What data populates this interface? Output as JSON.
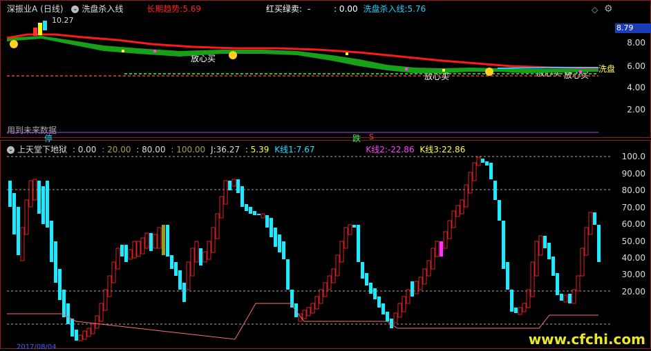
{
  "top_panel": {
    "stock_name": "深振业A",
    "period": "(日线)",
    "indicator_name": "洗盘杀入线",
    "long_trend_label": "长期趋势:",
    "long_trend_value": "5.69",
    "red_buy_label": "红买绿卖:",
    "red_buy_value": "-",
    "zero_value": ": 0.00",
    "wash_line_label": "洗盘杀入线:",
    "wash_line_value": "5.76",
    "price_high_label": "10.27",
    "current_price": "8.79",
    "y_ticks": [
      "8.00",
      "6.00",
      "4.00",
      "2.00"
    ],
    "annotation_buy": "放心买",
    "annotation_wash": "洗盘",
    "future_data_note": "用到未来数据",
    "stop_marker": "停",
    "fall_marker": "跌",
    "s_marker": "S",
    "colors": {
      "long_trend": "#ff2020",
      "wash": "#20d0ff",
      "red_buy": "#ffffff"
    }
  },
  "bottom_panel": {
    "indicator_name": "上天堂下地狱",
    "v1": ": 0.00",
    "v2": ": 20.00",
    "v3": ": 80.00",
    "v4": ": 100.00",
    "j_label": "J:",
    "j_value": "36.27",
    "v5": ": 5.39",
    "k1_label": "K线1:",
    "k1_value": "7.67",
    "k2_label": "K线2:",
    "k2_value": "-22.86",
    "k3_label": "K线3:",
    "k3_value": "22.86",
    "y_ticks": [
      "100.0",
      "90.00",
      "80.00",
      "70.00",
      "60.00",
      "50.00",
      "40.00",
      "30.00",
      "20.00"
    ],
    "colors": {
      "k1": "#20e0ff",
      "k2": "#ff40ff",
      "k3": "#ffff40",
      "j": "#ffffff"
    }
  },
  "footer": {
    "date_text": "2017/08/04",
    "watermark": "www.cfchi.com"
  }
}
